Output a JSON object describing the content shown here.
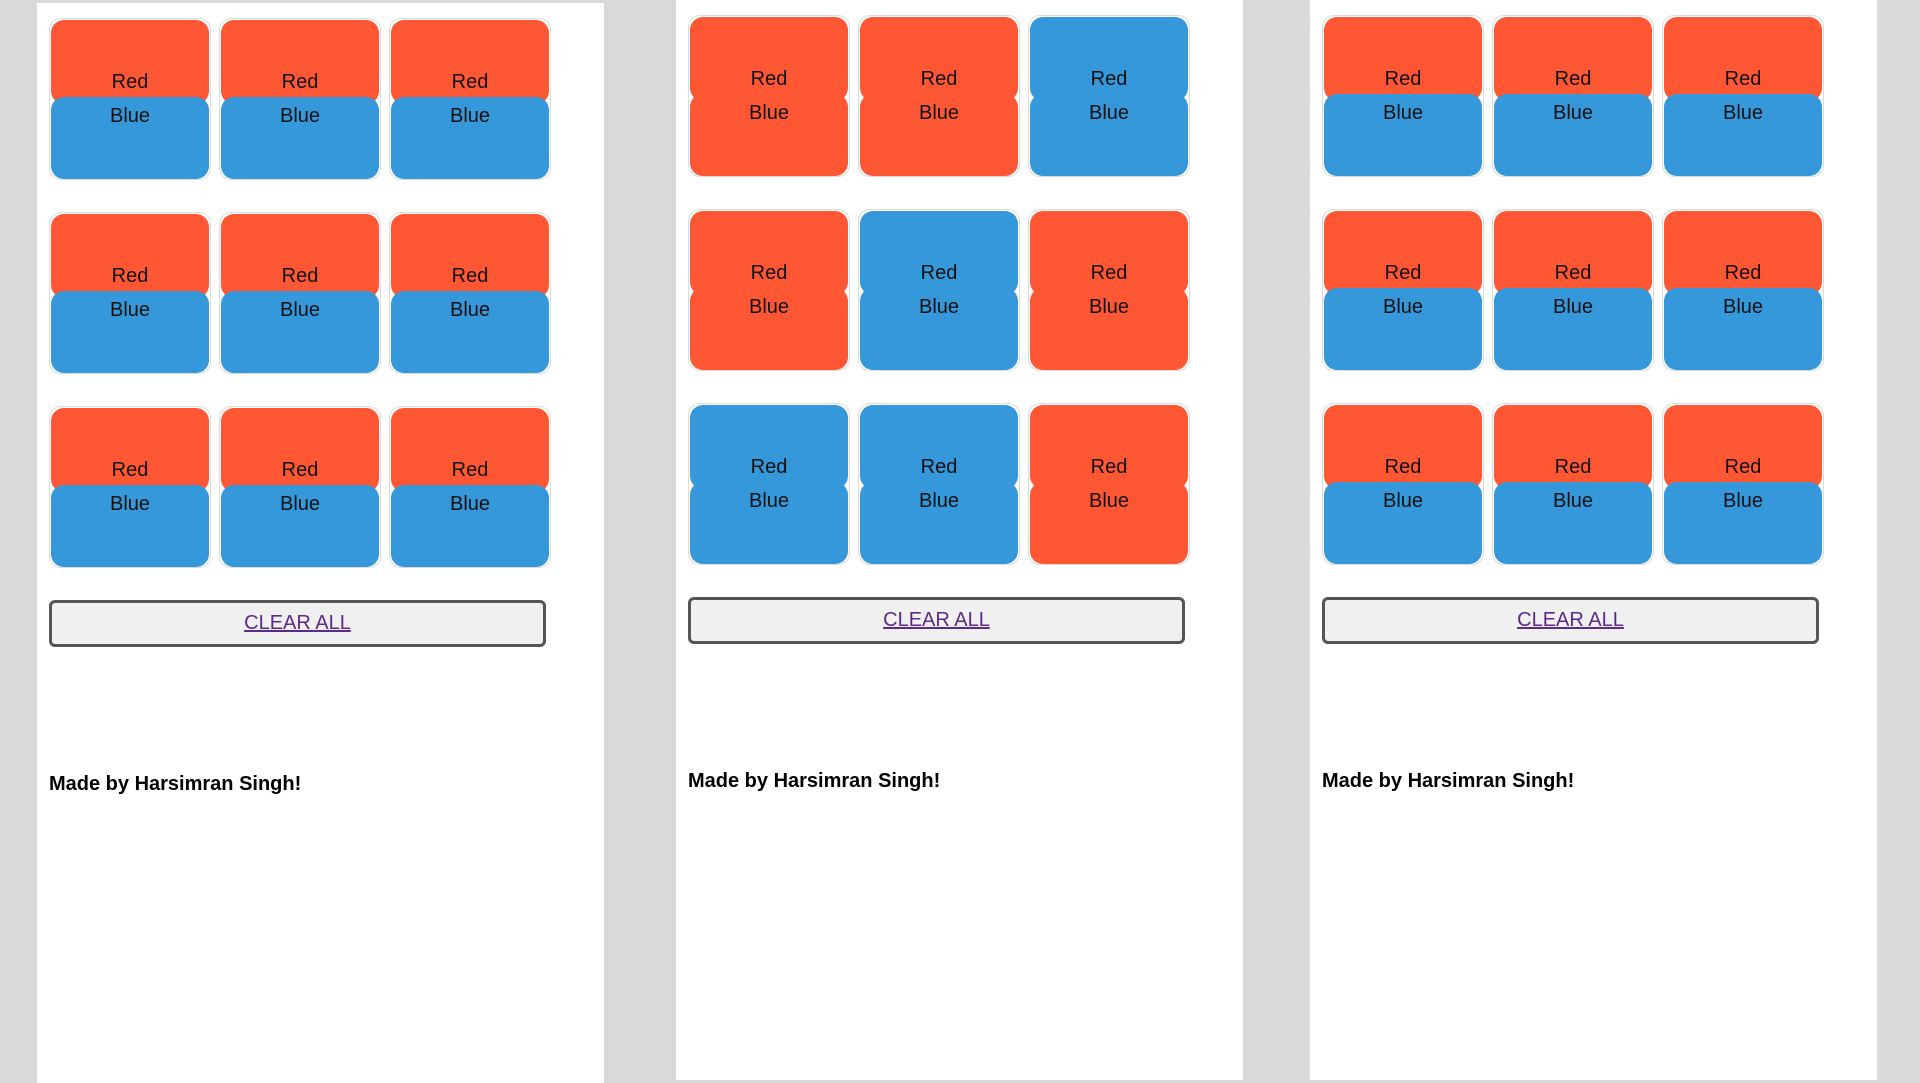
{
  "colors": {
    "red": "#ff5733",
    "blue": "#3498db",
    "page_background": "#d9d9d9",
    "panel_background": "#ffffff"
  },
  "labels": {
    "top": "Red",
    "bottom": "Blue"
  },
  "panels": [
    {
      "cells": [
        [
          "red",
          "blue"
        ],
        [
          "red",
          "blue"
        ],
        [
          "red",
          "blue"
        ],
        [
          "red",
          "blue"
        ],
        [
          "red",
          "blue"
        ],
        [
          "red",
          "blue"
        ],
        [
          "red",
          "blue"
        ],
        [
          "red",
          "blue"
        ],
        [
          "red",
          "blue"
        ]
      ],
      "clear_label": "CLEAR ALL",
      "credit": "Made by Harsimran Singh!"
    },
    {
      "cells": [
        [
          "red",
          "red"
        ],
        [
          "red",
          "red"
        ],
        [
          "blue",
          "blue"
        ],
        [
          "red",
          "red"
        ],
        [
          "blue",
          "blue"
        ],
        [
          "red",
          "red"
        ],
        [
          "blue",
          "blue"
        ],
        [
          "blue",
          "blue"
        ],
        [
          "red",
          "red"
        ]
      ],
      "clear_label": "CLEAR ALL",
      "credit": "Made by Harsimran Singh!"
    },
    {
      "cells": [
        [
          "red",
          "blue"
        ],
        [
          "red",
          "blue"
        ],
        [
          "red",
          "blue"
        ],
        [
          "red",
          "blue"
        ],
        [
          "red",
          "blue"
        ],
        [
          "red",
          "blue"
        ],
        [
          "red",
          "blue"
        ],
        [
          "red",
          "blue"
        ],
        [
          "red",
          "blue"
        ]
      ],
      "clear_label": "CLEAR ALL",
      "credit": "Made by Harsimran Singh!"
    }
  ]
}
